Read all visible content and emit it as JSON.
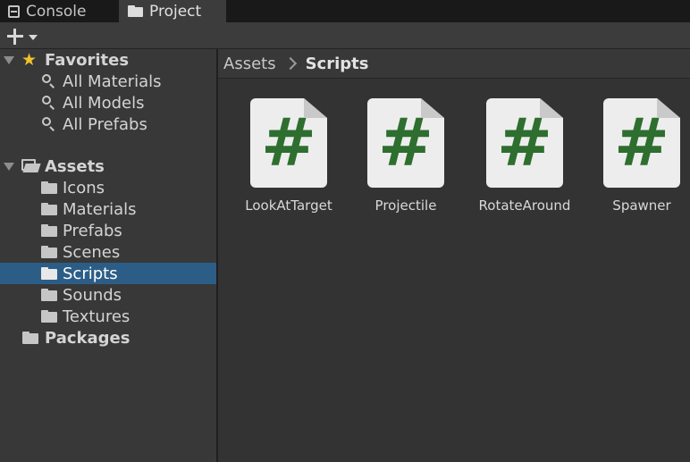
{
  "tabs": [
    {
      "label": "Console",
      "icon": "console-icon"
    },
    {
      "label": "Project",
      "icon": "folder-icon",
      "active": true
    }
  ],
  "toolbar": {
    "add_icon": "plus-icon",
    "dropdown_icon": "caret-down-icon"
  },
  "sidebar": {
    "favorites": {
      "label": "Favorites",
      "items": [
        "All Materials",
        "All Models",
        "All Prefabs"
      ]
    },
    "assets": {
      "label": "Assets",
      "children": [
        "Icons",
        "Materials",
        "Prefabs",
        "Scenes",
        "Scripts",
        "Sounds",
        "Textures"
      ],
      "selected": "Scripts"
    },
    "packages": {
      "label": "Packages"
    }
  },
  "breadcrumb": {
    "root": "Assets",
    "current": "Scripts"
  },
  "assets": [
    {
      "name": "LookAtTarget",
      "glyph": "#"
    },
    {
      "name": "Projectile",
      "glyph": "#"
    },
    {
      "name": "RotateAround",
      "glyph": "#"
    },
    {
      "name": "Spawner",
      "glyph": "#"
    }
  ],
  "colors": {
    "selection": "#2c5d87",
    "csharp_glyph": "#2e6e2f",
    "favorite_star": "#f2c12e"
  }
}
